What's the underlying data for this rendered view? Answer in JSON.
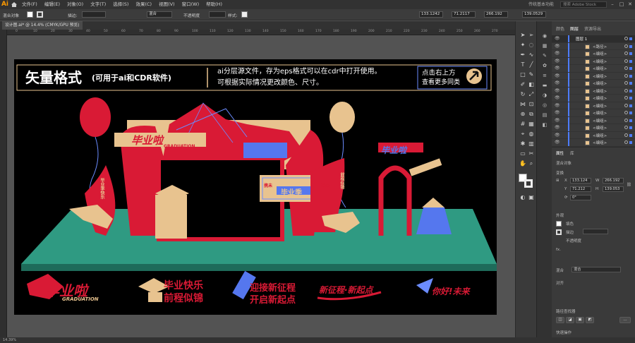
{
  "app": {
    "logo": "Ai",
    "workspace": "传统基本功能",
    "search_placeholder": "搜索 Adobe Stock"
  },
  "menu": [
    "文件(F)",
    "编辑(E)",
    "对象(O)",
    "文字(T)",
    "选择(S)",
    "效果(C)",
    "视图(V)",
    "窗口(W)",
    "帮助(H)"
  ],
  "control": {
    "no_selection": "混合对象",
    "stroke_label": "描边:",
    "blend_mode": "混合",
    "opacity_label": "不透明度",
    "style_label": "样式:",
    "x": "133.1242",
    "y": "71.2117",
    "w": "266.192",
    "h": "139.0529"
  },
  "document": {
    "tab_label": "设计图.ai* @ 14.4% (CMYK/GPU 预览)",
    "zoom": "14.39%"
  },
  "ruler_ticks": [
    "0",
    "10",
    "20",
    "30",
    "40",
    "50",
    "60",
    "70",
    "80",
    "90",
    "100",
    "110",
    "120",
    "130",
    "140",
    "150",
    "160",
    "170",
    "180",
    "190",
    "200",
    "210",
    "220",
    "230",
    "240",
    "250",
    "260",
    "270"
  ],
  "artwork": {
    "title_main": "矢量格式",
    "title_sub": "(可用于ai和CDR软件)",
    "info_line1": "ai分层源文件，存为eps格式可以在cdr中打开使用。",
    "info_line2": "可根据实际情况更改颜色、尺寸。",
    "cta_line1": "点击右上方",
    "cta_line2": "查看更多同类",
    "arch_text": "毕业啦",
    "arch_sub": "GRADUATION",
    "ticket_text": "毕业季",
    "ticket_left": "携未",
    "ticket_right": "来未",
    "banner_left": "毕业季快乐",
    "banner_right": "前程似锦",
    "panel_text": "毕业啦",
    "b1": "毕业啦",
    "b1_sub": "GRADUATION",
    "b2_l1": "毕业快乐",
    "b2_l2": "前程似锦",
    "b3_l1": "迎接新征程",
    "b3_l2": "开启新起点",
    "b4": "新征程·新起点",
    "b5": "你好!未来"
  },
  "panels": {
    "tabs": [
      "颜色",
      "图层",
      "资源导出"
    ],
    "layer_top": "图层 1",
    "layer_name": "<编组>",
    "layer_first": "<路径>",
    "properties_tabs": [
      "属性",
      "库"
    ],
    "section_mixed": "混合对象",
    "transform_label": "变换",
    "px": "133.124",
    "py": "71.212",
    "pw": "266.192",
    "ph": "139.053",
    "angle": "0°",
    "appearance_label": "外观",
    "fill_label": "填色",
    "stroke_label": "描边",
    "opacity_label": "不透明度",
    "fx_label": "fx.",
    "blend_label": "混合",
    "blend_value": "混合",
    "align_label": "对齐",
    "pathfinder_label": "路径查找器",
    "quick_label": "快速操作"
  },
  "colors": {
    "accent": "#4d7cff",
    "art_red": "#d91a35",
    "art_gold": "#e8c38f",
    "art_green": "#2f9a82",
    "art_blue": "#5577ee"
  }
}
